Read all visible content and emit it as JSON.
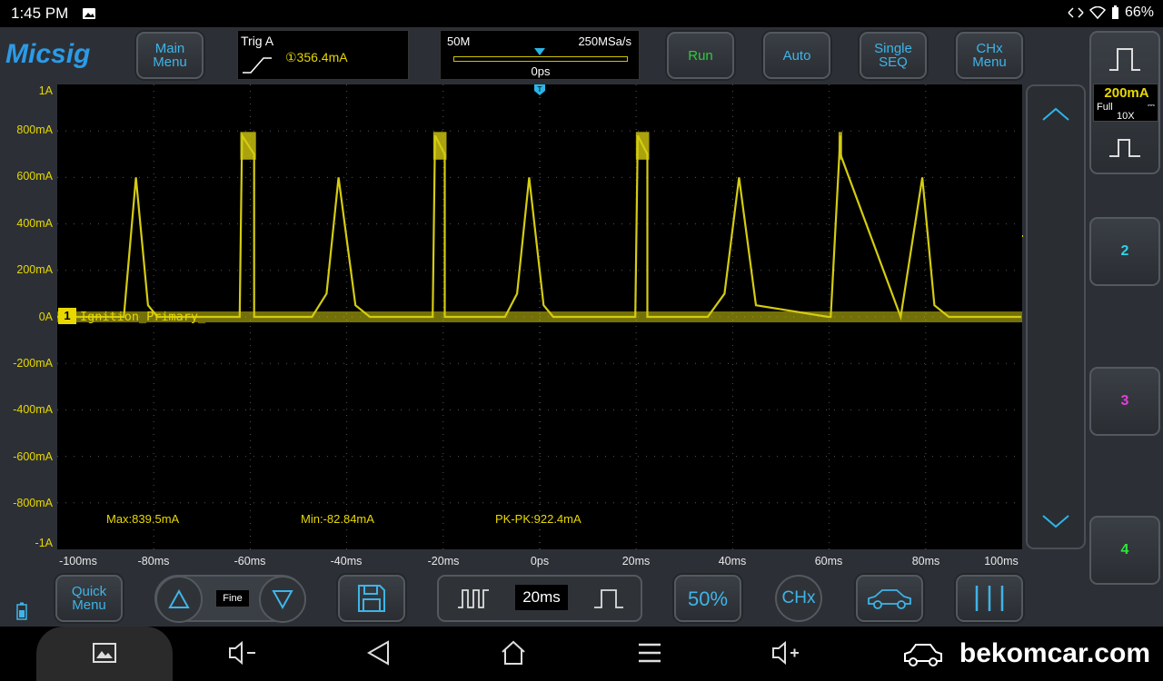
{
  "status_bar": {
    "time": "1:45 PM",
    "battery": "66%"
  },
  "app": {
    "logo": "Micsig",
    "buttons": {
      "main_menu": "Main\nMenu",
      "run": "Run",
      "auto": "Auto",
      "single_seq": "Single\nSEQ",
      "chx_menu": "CHx\nMenu",
      "quick_menu": "Quick\nMenu",
      "fine": "Fine",
      "timebase": "20ms",
      "fifty_percent": "50%",
      "chx": "CHx"
    },
    "trigger": {
      "title": "Trig A",
      "source_level": "①356.4mA"
    },
    "timebase_panel": {
      "memory_depth": "50M",
      "sample_rate": "250MSa/s",
      "offset": "0ps",
      "position_fraction": 0.5
    },
    "channels": [
      "2",
      "3",
      "4"
    ],
    "channel_colors": {
      "ch2": "#2bd4e8",
      "ch3": "#e23fd8",
      "ch4": "#2ee83a"
    },
    "scale": {
      "value": "200mA",
      "coupling": "Full",
      "probe": "10X"
    }
  },
  "chart_data": {
    "type": "line",
    "x_unit": "ms",
    "y_unit": "mA",
    "xlim": [
      -100,
      100
    ],
    "ylim": [
      -1000,
      1000
    ],
    "grid": true,
    "y_tick_labels": [
      "1A",
      "800mA",
      "600mA",
      "400mA",
      "200mA",
      "0A",
      "-200mA",
      "-400mA",
      "-600mA",
      "-800mA",
      "-1A"
    ],
    "x_tick_labels": [
      "-100ms",
      "-80ms",
      "-60ms",
      "-40ms",
      "-20ms",
      "0ps",
      "20ms",
      "40ms",
      "60ms",
      "80ms",
      "100ms"
    ],
    "series": [
      {
        "name": "Ignition_Primary_",
        "channel": "1",
        "color": "#d4cc10",
        "x": [
          -100,
          -86,
          -83.5,
          -81,
          -79,
          -62,
          -61.5,
          -59,
          -59,
          -47,
          -44,
          -41.5,
          -38,
          -35,
          -22,
          -21.5,
          -19.5,
          -19.5,
          -7,
          -4.5,
          -2,
          1,
          3,
          20,
          20.5,
          22.5,
          22.5,
          35,
          38.5,
          41.5,
          45,
          60,
          60.5,
          62.5,
          62.5,
          75,
          79.5,
          82,
          85,
          100
        ],
        "y": [
          0,
          0,
          600,
          50,
          0,
          0,
          780,
          700,
          0,
          0,
          100,
          600,
          50,
          0,
          0,
          780,
          700,
          0,
          0,
          100,
          600,
          50,
          0,
          0,
          780,
          700,
          0,
          0,
          100,
          600,
          50,
          0,
          0,
          780,
          700,
          0,
          600,
          50,
          0,
          0
        ]
      }
    ],
    "trigger_level": 356.4,
    "trigger_position": 0,
    "measurements": {
      "max": "Max:839.5mA",
      "min": "Min:-82.84mA",
      "pk_pk": "PK-PK:922.4mA"
    }
  },
  "icons": [
    "battery-icon",
    "wifi-icon",
    "photo-icon",
    "save-icon",
    "car-icon",
    "pulse-wide-icon",
    "pulse-narrow-icon",
    "up-triangle-icon",
    "down-triangle-icon",
    "volume-down-icon",
    "volume-up-icon",
    "back-icon",
    "home-icon",
    "menu-icon",
    "screenshot-icon"
  ],
  "watermark": "bekomcar.com"
}
